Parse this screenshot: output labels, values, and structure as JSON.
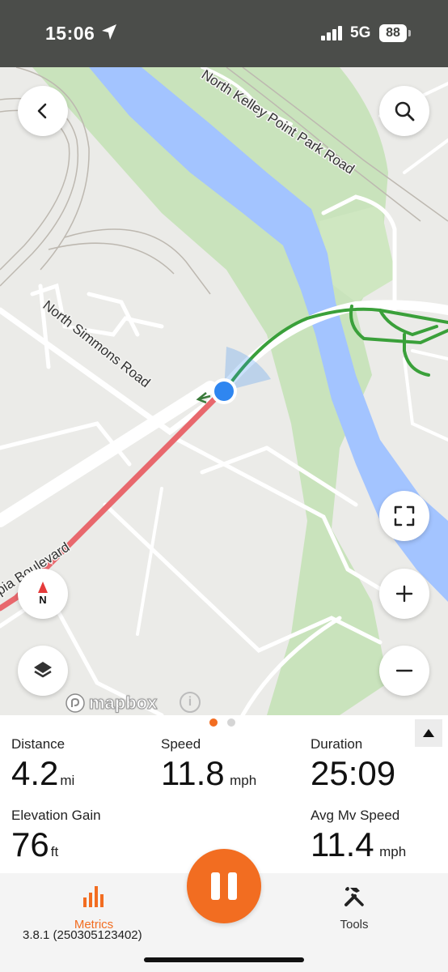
{
  "status_bar": {
    "time": "15:06",
    "network": "5G",
    "battery": "88"
  },
  "map": {
    "roads": {
      "kelley": "North Kelley Point Park Road",
      "simmons": "North Simmons Road",
      "boulevard": "pia Boulevard"
    },
    "compass_label": "N",
    "attribution": "mapbox",
    "colors": {
      "land": "#ebebe8",
      "water": "#a3c4ff",
      "park": "#c9e3bc",
      "route_recorded": "#e8686d",
      "trail": "#3aa03a",
      "location": "#2f86f0"
    },
    "icons": {
      "back": "chevron-left-icon",
      "search": "search-icon",
      "fullscreen": "fullscreen-icon",
      "zoom_in": "plus-icon",
      "zoom_out": "minus-icon",
      "layers": "layers-icon",
      "compass": "compass-icon"
    }
  },
  "metrics": {
    "distance": {
      "label": "Distance",
      "value": "4.2",
      "unit": "mi"
    },
    "speed": {
      "label": "Speed",
      "value": "11.8",
      "unit": "mph"
    },
    "duration": {
      "label": "Duration",
      "value": "25:09"
    },
    "elevation": {
      "label": "Elevation Gain",
      "value": "76",
      "unit": "ft"
    },
    "avg_speed": {
      "label": "Avg Mv Speed",
      "value": "11.4",
      "unit": "mph"
    },
    "page_indicator": {
      "current": 1,
      "total": 2
    }
  },
  "bottom_bar": {
    "metrics_tab": "Metrics",
    "tools_tab": "Tools",
    "version": "3.8.1 (250305123402)",
    "accent_color": "#f26d21"
  }
}
